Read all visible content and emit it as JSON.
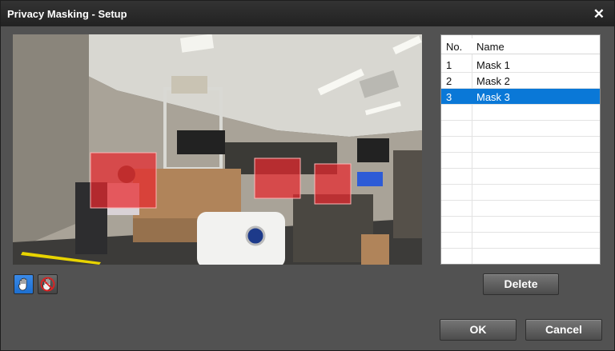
{
  "dialog": {
    "title": "Privacy Masking - Setup",
    "close_icon": "close-icon"
  },
  "mask_table": {
    "headers": [
      "No.",
      "Name"
    ],
    "rows": [
      {
        "no": "1",
        "name": "Mask 1",
        "selected": false
      },
      {
        "no": "2",
        "name": "Mask 2",
        "selected": false
      },
      {
        "no": "3",
        "name": "Mask 3",
        "selected": true
      }
    ]
  },
  "tools": [
    {
      "icon": "hand-icon",
      "active": true
    },
    {
      "icon": "erase-mask-icon",
      "active": false
    }
  ],
  "buttons": {
    "delete": "Delete",
    "ok": "OK",
    "cancel": "Cancel"
  },
  "colors": {
    "selection": "#0a78d7",
    "mask_fill": "#e8282e",
    "tool_active": "#1d6fd0"
  }
}
